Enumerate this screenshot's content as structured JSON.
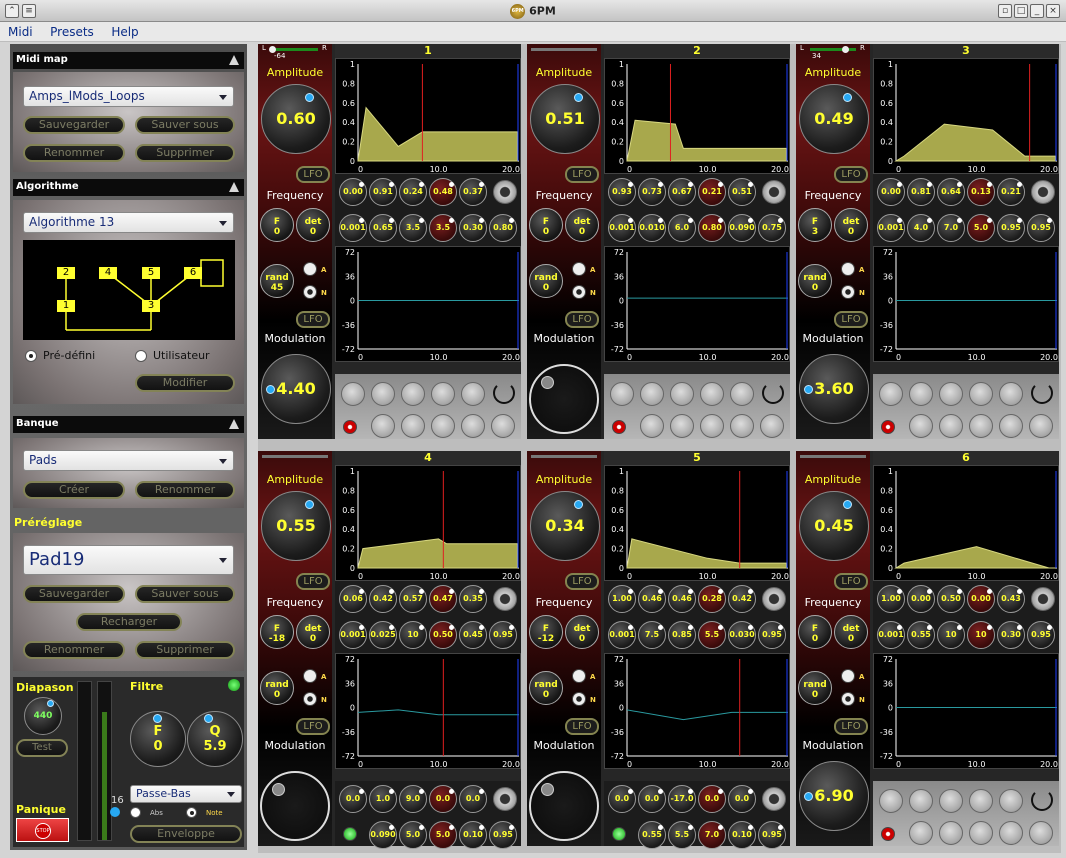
{
  "window": {
    "title": "6PM",
    "logo": "6PM"
  },
  "menu": [
    "Midi",
    "Presets",
    "Help"
  ],
  "sidebar": {
    "midi": {
      "title": "Midi map",
      "selected": "Amps_lMods_Loops",
      "buttons": [
        "Sauvegarder",
        "Sauver sous",
        "Renommer",
        "Supprimer"
      ]
    },
    "algo": {
      "title": "Algorithme",
      "selected": "Algorithme 13",
      "radios": [
        "Pré-défini",
        "Utilisateur"
      ],
      "modify": "Modifier",
      "ops": [
        "2",
        "4",
        "5",
        "6",
        "1",
        "3"
      ]
    },
    "bank": {
      "title": "Banque",
      "selected": "Pads",
      "buttons": [
        "Créer",
        "Renommer"
      ]
    },
    "preset": {
      "title": "Préréglage",
      "selected": "Pad19",
      "buttons": [
        "Sauvegarder",
        "Sauver sous",
        "Recharger",
        "Renommer",
        "Supprimer"
      ]
    },
    "diapason": {
      "label": "Diapason",
      "value": "440",
      "test": "Test"
    },
    "panic": {
      "label": "Panique",
      "stop": "STOP"
    },
    "volume": "16",
    "filter": {
      "label": "Filtre",
      "f_label": "F",
      "f_value": "0",
      "q_label": "Q",
      "q_value": "5.9",
      "type": "Passe-Bas",
      "abs": "Abs",
      "note": "Note",
      "env": "Enveloppe"
    }
  },
  "labels": {
    "amp": "Amplitude",
    "freq": "Frequency",
    "mod": "Modulation",
    "lfo": "LFO",
    "rand": "rand",
    "f": "F",
    "det": "det",
    "a": "A",
    "n": "N",
    "L": "L",
    "R": "R"
  },
  "axes": {
    "amp_y": [
      "1",
      "0.8",
      "0.6",
      "0.4",
      "0.2",
      "0"
    ],
    "freq_y": [
      "72",
      "36",
      "0",
      "-36",
      "-72"
    ],
    "x": [
      "0",
      "10.0",
      "20.0"
    ]
  },
  "operators": [
    {
      "num": "1",
      "pan": "-64",
      "amp": "0.60",
      "mod": "4.40",
      "f": "0",
      "det": "0",
      "rand": "45",
      "r1": [
        "0.00",
        "0.91",
        "0.24",
        "0.48",
        "0.37"
      ],
      "r2": [
        "0.001",
        "0.65",
        "3.5",
        "3.5",
        "0.30",
        "0.80"
      ]
    },
    {
      "num": "2",
      "pan": "",
      "amp": "0.51",
      "mod": "",
      "f": "0",
      "det": "0",
      "rand": "0",
      "r1": [
        "0.93",
        "0.73",
        "0.67",
        "0.21",
        "0.51"
      ],
      "r2": [
        "0.001",
        "0.010",
        "6.0",
        "0.80",
        "0.090",
        "0.75"
      ]
    },
    {
      "num": "3",
      "pan": "34",
      "amp": "0.49",
      "mod": "3.60",
      "f": "3",
      "det": "0",
      "rand": "0",
      "r1": [
        "0.00",
        "0.81",
        "0.64",
        "0.13",
        "0.21"
      ],
      "r2": [
        "0.001",
        "4.0",
        "7.0",
        "5.0",
        "0.95",
        "0.95"
      ]
    },
    {
      "num": "4",
      "pan": "",
      "amp": "0.55",
      "mod": "",
      "f": "-18",
      "det": "0",
      "rand": "0",
      "r1": [
        "0.06",
        "0.42",
        "0.57",
        "0.47",
        "0.35"
      ],
      "r2": [
        "0.001",
        "0.025",
        "10",
        "0.50",
        "0.45",
        "0.95"
      ],
      "r3": [
        "0.0",
        "1.0",
        "9.0",
        "0.0",
        "0.0"
      ],
      "r4": [
        "0.090",
        "5.0",
        "5.0",
        "0.10",
        "0.95"
      ]
    },
    {
      "num": "5",
      "pan": "",
      "amp": "0.34",
      "mod": "",
      "f": "-12",
      "det": "0",
      "rand": "0",
      "r1": [
        "1.00",
        "0.46",
        "0.46",
        "0.28",
        "0.42"
      ],
      "r2": [
        "0.001",
        "7.5",
        "0.85",
        "5.5",
        "0.030",
        "0.95"
      ],
      "r3": [
        "0.0",
        "0.0",
        "-17.0",
        "0.0",
        "0.0"
      ],
      "r4": [
        "0.55",
        "5.5",
        "7.0",
        "0.10",
        "0.95"
      ]
    },
    {
      "num": "6",
      "pan": "",
      "amp": "0.45",
      "mod": "6.90",
      "f": "0",
      "det": "0",
      "rand": "0",
      "r1": [
        "1.00",
        "0.00",
        "0.50",
        "0.00",
        "0.43"
      ],
      "r2": [
        "0.001",
        "0.55",
        "10",
        "10",
        "0.30",
        "0.95"
      ]
    }
  ],
  "colors": {
    "accent": "#ffff30",
    "knob_dot": "#27a8f2",
    "envelope": "#a8a84c"
  }
}
